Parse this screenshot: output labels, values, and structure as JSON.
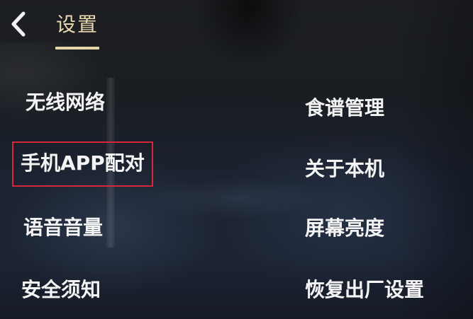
{
  "header": {
    "back_icon": "chevron-left-icon",
    "title": "设置"
  },
  "menu": {
    "left": [
      {
        "label": "无线网络"
      },
      {
        "label": "手机APP配对"
      },
      {
        "label": "语音音量"
      },
      {
        "label": "安全须知"
      }
    ],
    "right": [
      {
        "label": "食谱管理"
      },
      {
        "label": "关于本机"
      },
      {
        "label": "屏幕亮度"
      },
      {
        "label": "恢复出厂设置"
      }
    ]
  },
  "colors": {
    "title": "#ead9b0",
    "text": "#f4f4f4",
    "selection_box": "#d8263a",
    "background": "#1b2230"
  }
}
